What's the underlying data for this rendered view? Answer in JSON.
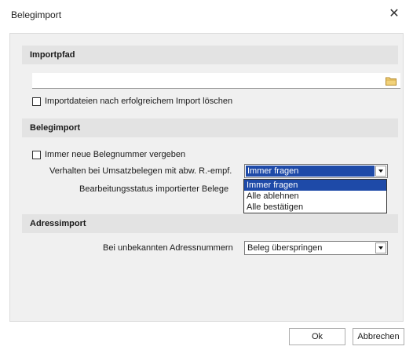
{
  "dialog": {
    "title": "Belegimport"
  },
  "importpfad": {
    "header": "Importpfad",
    "path_value": "",
    "delete_checkbox_label": "Importdateien nach erfolgreichem Import löschen",
    "delete_checked": false
  },
  "belegimport": {
    "header": "Belegimport",
    "new_number_label": "Immer neue Belegnummer vergeben",
    "new_number_checked": false,
    "verhalten_label": "Verhalten bei Umsatzbelegen mit abw. R.-empf.",
    "verhalten_value": "Immer fragen",
    "verhalten_options": [
      "Immer fragen",
      "Alle ablehnen",
      "Alle bestätigen"
    ],
    "status_label": "Bearbeitungsstatus importierter Belege"
  },
  "adressimport": {
    "header": "Adressimport",
    "unknown_label": "Bei unbekannten Adressnummern",
    "unknown_value": "Beleg überspringen"
  },
  "buttons": {
    "ok": "Ok",
    "cancel": "Abbrechen"
  },
  "colors": {
    "selection": "#1e4aa8",
    "panel": "#f0f0f0",
    "section_header": "#e3e3e3"
  }
}
